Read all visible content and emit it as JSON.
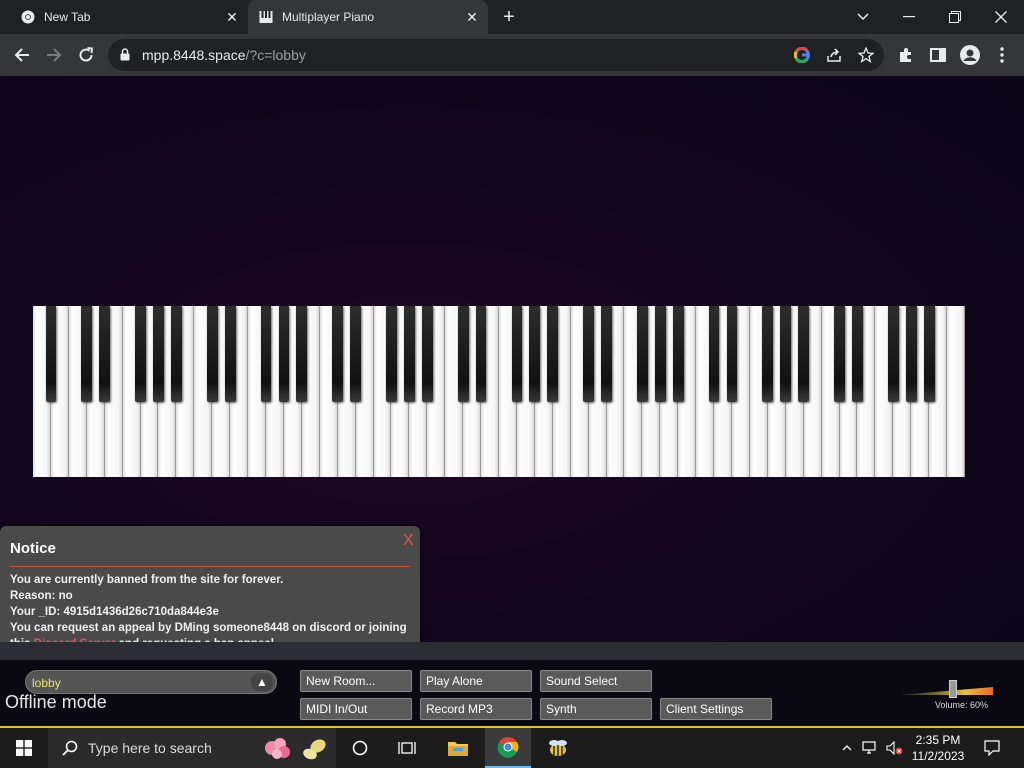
{
  "browser": {
    "tabs": [
      {
        "title": "New Tab",
        "active": false
      },
      {
        "title": "Multiplayer Piano",
        "active": true
      }
    ],
    "url_domain": "mpp.8448.space",
    "url_path": "/?c=lobby"
  },
  "notice": {
    "title": "Notice",
    "close": "X",
    "line1": "You are currently banned from the site for forever.",
    "line2": "Reason: no",
    "line3": "Your _ID: 4915d1436d26c710da844e3e",
    "line4": "You can request an appeal by DMing someone8448 on discord or joining",
    "line5_pre": "this ",
    "line5_link": "Discord Server",
    "line5_post": " and requesting a ban appeal."
  },
  "controls": {
    "room": "lobby",
    "room_arrow": "▲",
    "offline": "Offline mode",
    "new_room": "New Room...",
    "play_alone": "Play Alone",
    "sound_select": "Sound Select",
    "midi": "MIDI In/Out",
    "record": "Record MP3",
    "synth": "Synth",
    "client_settings": "Client Settings",
    "volume_label": "Volume: 60%",
    "volume_level": 0.6
  },
  "taskbar": {
    "search_placeholder": "Type here to search",
    "time": "2:35 PM",
    "date": "11/2/2023"
  },
  "colors": {
    "accent_link": "#e4506a",
    "room_text": "#e9e36b",
    "taskbar_border": "#e0c22c"
  }
}
